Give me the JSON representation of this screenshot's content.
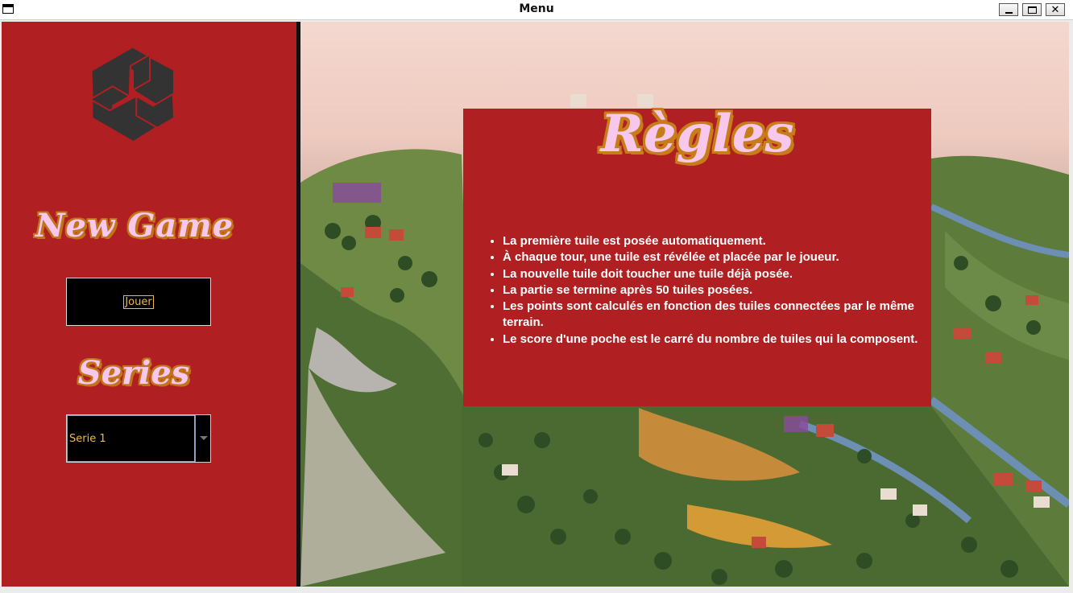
{
  "window": {
    "title": "Menu",
    "controls": {
      "minimize": "minimize-icon",
      "maximize": "maximize-icon",
      "close": "✕"
    }
  },
  "sidebar": {
    "logo_icon": "hexagonal-spiral-logo-icon",
    "new_game_title": "New Game",
    "play_button_label": "Jouer",
    "series_title": "Series",
    "series_select": {
      "value": "Serie 1",
      "arrow_icon": "chevron-down-icon"
    }
  },
  "rules": {
    "title": "Règles",
    "items": [
      "La première tuile est posée automatiquement.",
      "À chaque tour, une tuile est révélée et placée par le joueur.",
      "La nouvelle tuile doit toucher une tuile déjà posée.",
      "La partie se termine après 50 tuiles posées.",
      "Les points sont calculés en fonction des tuiles connectées par le même terrain.",
      "Le score d'une poche est le carré du nombre de tuiles qui la composent."
    ]
  },
  "colors": {
    "panel_red": "#b01f21",
    "title_pink": "#f8c8ec",
    "title_outline": "#c2741b",
    "button_text": "#f0b94a",
    "logo_dark": "#333333"
  }
}
